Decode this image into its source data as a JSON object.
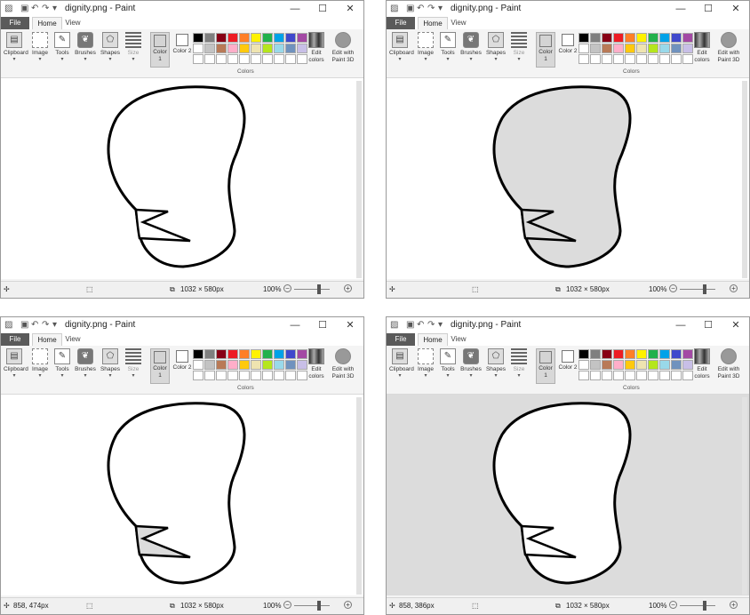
{
  "windows": [
    {
      "title": "dignity.png - Paint",
      "tabs": {
        "file": "File",
        "home": "Home",
        "view": "View"
      },
      "groups": {
        "clipboard": "Clipboard",
        "image": "Image",
        "tools": "Tools",
        "brushes": "Brushes",
        "shapes": "Shapes",
        "size": "Size"
      },
      "color1": "Color 1",
      "color2": "Color 2",
      "edit_colors": "Edit colors",
      "paint3d": "Edit with Paint 3D",
      "colors_label": "Colors",
      "status": {
        "cursor": "",
        "selection": "",
        "dimensions": "1032 × 580px",
        "zoom": "100%"
      },
      "fill": {
        "outer": "#ffffff",
        "bowl": "#ffffff",
        "inner": "#ffffff",
        "background": "#ffffff"
      }
    },
    {
      "title": "dignity.png - Paint",
      "tabs": {
        "file": "File",
        "home": "Home",
        "view": "View"
      },
      "groups": {
        "clipboard": "Clipboard",
        "image": "Image",
        "tools": "Tools",
        "brushes": "Brushes",
        "shapes": "Shapes",
        "size": "Size"
      },
      "color1": "Color 1",
      "color2": "Color 2",
      "edit_colors": "Edit colors",
      "paint3d": "Edit with Paint 3D",
      "colors_label": "Colors",
      "status": {
        "cursor": "",
        "selection": "",
        "dimensions": "1032 × 580px",
        "zoom": "100%"
      },
      "fill": {
        "outer": "#dcdcdc",
        "bowl": "#dcdcdc",
        "inner": "#dcdcdc",
        "background": "#ffffff"
      }
    },
    {
      "title": "dignity.png - Paint",
      "tabs": {
        "file": "File",
        "home": "Home",
        "view": "View"
      },
      "groups": {
        "clipboard": "Clipboard",
        "image": "Image",
        "tools": "Tools",
        "brushes": "Brushes",
        "shapes": "Shapes",
        "size": "Size"
      },
      "color1": "Color 1",
      "color2": "Color 2",
      "edit_colors": "Edit colors",
      "paint3d": "Edit with Paint 3D",
      "colors_label": "Colors",
      "status": {
        "cursor": "858, 474px",
        "selection": "",
        "dimensions": "1032 × 580px",
        "zoom": "100%"
      },
      "fill": {
        "outer": "#ffffff",
        "bowl": "#ffffff",
        "inner": "#dcdcdc",
        "background": "#ffffff"
      }
    },
    {
      "title": "dignity.png - Paint",
      "tabs": {
        "file": "File",
        "home": "Home",
        "view": "View"
      },
      "groups": {
        "clipboard": "Clipboard",
        "image": "Image",
        "tools": "Tools",
        "brushes": "Brushes",
        "shapes": "Shapes",
        "size": "Size"
      },
      "color1": "Color 1",
      "color2": "Color 2",
      "edit_colors": "Edit colors",
      "paint3d": "Edit with Paint 3D",
      "colors_label": "Colors",
      "status": {
        "cursor": "858, 386px",
        "selection": "",
        "dimensions": "1032 × 580px",
        "zoom": "100%"
      },
      "fill": {
        "outer": "#ffffff",
        "bowl": "#ffffff",
        "inner": "#ffffff",
        "background": "#dcdcdc"
      }
    }
  ],
  "palette": [
    "#000000",
    "#7f7f7f",
    "#880015",
    "#ed1c24",
    "#ff7f27",
    "#fff200",
    "#22b14c",
    "#00a2e8",
    "#3f48cc",
    "#a349a4",
    "#ffffff",
    "#c3c3c3",
    "#b97a57",
    "#ffaec9",
    "#ffc90e",
    "#efe4b0",
    "#b5e61d",
    "#99d9ea",
    "#7092be",
    "#c8bfe7",
    "#ffffff",
    "#ffffff",
    "#ffffff",
    "#ffffff",
    "#ffffff",
    "#ffffff",
    "#ffffff",
    "#ffffff",
    "#ffffff",
    "#ffffff"
  ],
  "colors": {
    "color1": "#d4d4d4",
    "color2": "#ffffff",
    "titlebar": "#ffffff",
    "file_tab": "#5a5a5a"
  },
  "icons": [
    "save-icon",
    "undo-icon",
    "redo-icon",
    "paste-icon",
    "select-icon",
    "pencil-icon",
    "brush-icon",
    "shapes-icon",
    "size-icon",
    "edit-colors-icon",
    "paint3d-icon",
    "minimize-icon",
    "maximize-icon",
    "close-icon",
    "move-icon",
    "selection-size-icon",
    "zoom-out-icon",
    "zoom-in-icon"
  ]
}
